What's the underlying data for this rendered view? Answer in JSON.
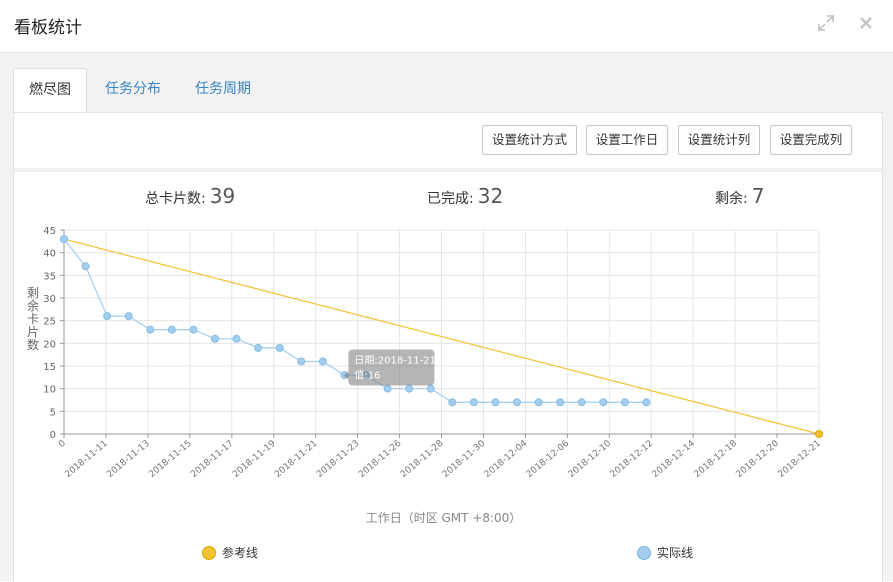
{
  "header": {
    "title": "看板统计"
  },
  "tabs": [
    {
      "label": "燃尽图",
      "active": true
    },
    {
      "label": "任务分布",
      "active": false
    },
    {
      "label": "任务周期",
      "active": false
    }
  ],
  "toolbar": {
    "buttons": [
      {
        "label": "设置统计方式"
      },
      {
        "label": "设置工作日"
      },
      {
        "label": "设置统计列"
      },
      {
        "label": "设置完成列"
      }
    ]
  },
  "stats": {
    "total_label": "总卡片数:",
    "total_value": "39",
    "done_label": "已完成:",
    "done_value": "32",
    "remain_label": "剩余:",
    "remain_value": "7"
  },
  "tooltip": {
    "line1": "日期:2018-11-21",
    "line2": "值:16"
  },
  "colors": {
    "reference": "#f2c230",
    "actual": "#a3cdee",
    "link": "#3a85c6"
  },
  "chart_data": {
    "type": "line",
    "xlabel": "工作日（时区 GMT +8:00）",
    "ylabel": "剩余卡片数",
    "ylim": [
      0,
      45
    ],
    "yticks": [
      0,
      5,
      10,
      15,
      20,
      25,
      30,
      35,
      40,
      45
    ],
    "x_tick_labels": [
      "0",
      "2018-11-11",
      "2018-11-13",
      "2018-11-15",
      "2018-11-17",
      "2018-11-19",
      "2018-11-21",
      "2018-11-23",
      "2018-11-26",
      "2018-11-28",
      "2018-11-30",
      "2018-12-04",
      "2018-12-06",
      "2018-12-10",
      "2018-12-12",
      "2018-12-14",
      "2018-12-18",
      "2018-12-20",
      "2018-12-21"
    ],
    "x_count": 36,
    "grid": true,
    "legend_position": "bottom",
    "series": [
      {
        "name": "参考线",
        "x": [
          0,
          35
        ],
        "values": [
          43,
          0
        ]
      },
      {
        "name": "实际线",
        "x": [
          0,
          1,
          2,
          3,
          4,
          5,
          6,
          7,
          8,
          9,
          10,
          11,
          12,
          13,
          14,
          15,
          16,
          17,
          18,
          19,
          20,
          21,
          22,
          23,
          24,
          25,
          26,
          27
        ],
        "values": [
          43,
          37,
          26,
          26,
          23,
          23,
          23,
          21,
          21,
          19,
          19,
          16,
          16,
          13,
          13,
          10,
          10,
          10,
          7,
          7,
          7,
          7,
          7,
          7,
          7,
          7,
          7,
          7
        ]
      }
    ]
  }
}
